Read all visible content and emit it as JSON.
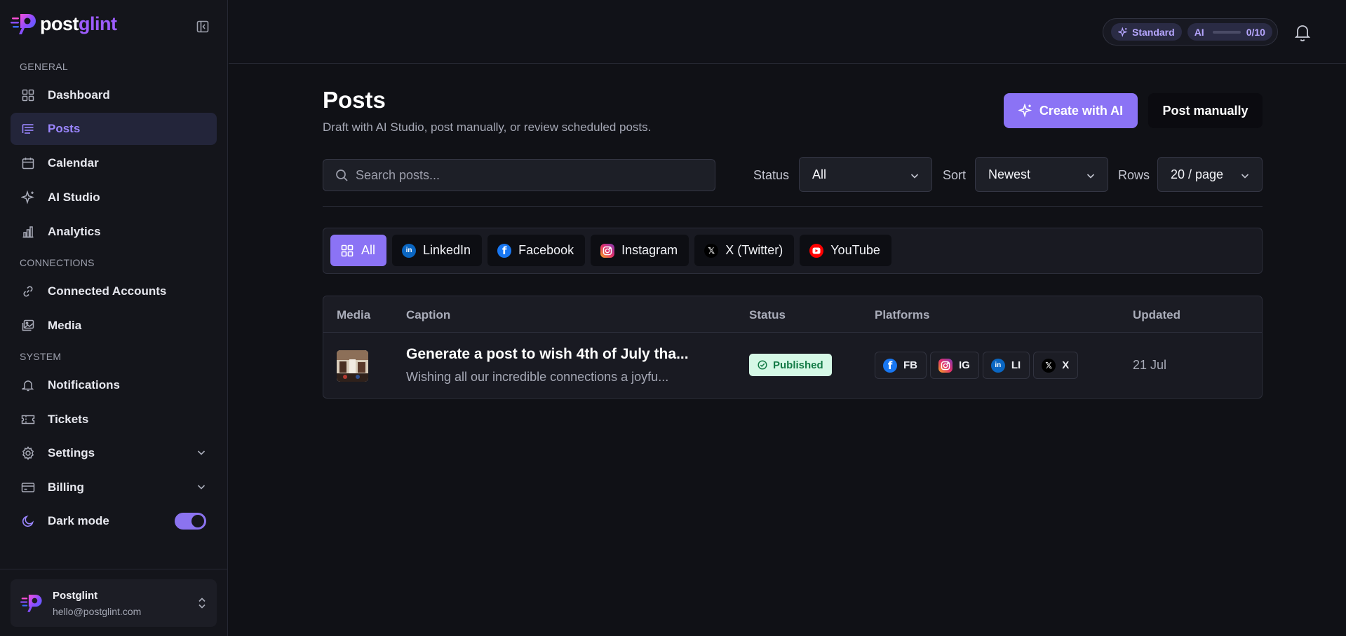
{
  "brand": {
    "name_part1": "post",
    "name_part2": "glint"
  },
  "sidebar": {
    "sections": {
      "general": "GENERAL",
      "connections": "CONNECTIONS",
      "system": "SYSTEM"
    },
    "items": [
      {
        "label": "Dashboard",
        "icon": "grid-icon"
      },
      {
        "label": "Posts",
        "icon": "posts-icon",
        "active": true
      },
      {
        "label": "Calendar",
        "icon": "calendar-icon"
      },
      {
        "label": "AI Studio",
        "icon": "sparkle-icon"
      },
      {
        "label": "Analytics",
        "icon": "bar-chart-icon"
      },
      {
        "label": "Connected Accounts",
        "icon": "link-icon"
      },
      {
        "label": "Media",
        "icon": "image-icon"
      },
      {
        "label": "Notifications",
        "icon": "bell-icon"
      },
      {
        "label": "Tickets",
        "icon": "ticket-icon"
      },
      {
        "label": "Settings",
        "icon": "gear-icon"
      },
      {
        "label": "Billing",
        "icon": "credit-card-icon"
      },
      {
        "label": "Dark mode",
        "icon": "moon-icon",
        "toggle_on": true
      }
    ],
    "account": {
      "name": "Postglint",
      "email": "hello@postglint.com"
    }
  },
  "header": {
    "plan": "Standard",
    "ai_label": "AI",
    "ai_usage": "0/10"
  },
  "page": {
    "title": "Posts",
    "subtitle": "Draft with AI Studio, post manually, or review scheduled posts.",
    "create_ai_label": "Create with AI",
    "post_manually_label": "Post manually"
  },
  "filters": {
    "search_placeholder": "Search posts...",
    "status_label": "Status",
    "status_value": "All",
    "sort_label": "Sort",
    "sort_value": "Newest",
    "rows_label": "Rows",
    "rows_value": "20 / page"
  },
  "tabs": [
    {
      "label": "All",
      "active": true
    },
    {
      "label": "LinkedIn",
      "icon": "linkedin-icon"
    },
    {
      "label": "Facebook",
      "icon": "facebook-icon"
    },
    {
      "label": "Instagram",
      "icon": "instagram-icon"
    },
    {
      "label": "X (Twitter)",
      "icon": "x-icon"
    },
    {
      "label": "YouTube",
      "icon": "youtube-icon"
    }
  ],
  "table": {
    "columns": [
      "Media",
      "Caption",
      "Status",
      "Platforms",
      "Updated"
    ],
    "rows": [
      {
        "caption_title": "Generate a post to wish 4th of July tha...",
        "caption_text": "Wishing all our incredible connections a joyfu...",
        "status": "Published",
        "platforms": [
          "FB",
          "IG",
          "LI",
          "X"
        ],
        "updated": "21 Jul"
      }
    ]
  },
  "colors": {
    "accent": "#8b73f5",
    "accent_text": "#9b86ff",
    "published_bg": "#d5f8e6",
    "published_text": "#127a45",
    "background": "#101116"
  }
}
